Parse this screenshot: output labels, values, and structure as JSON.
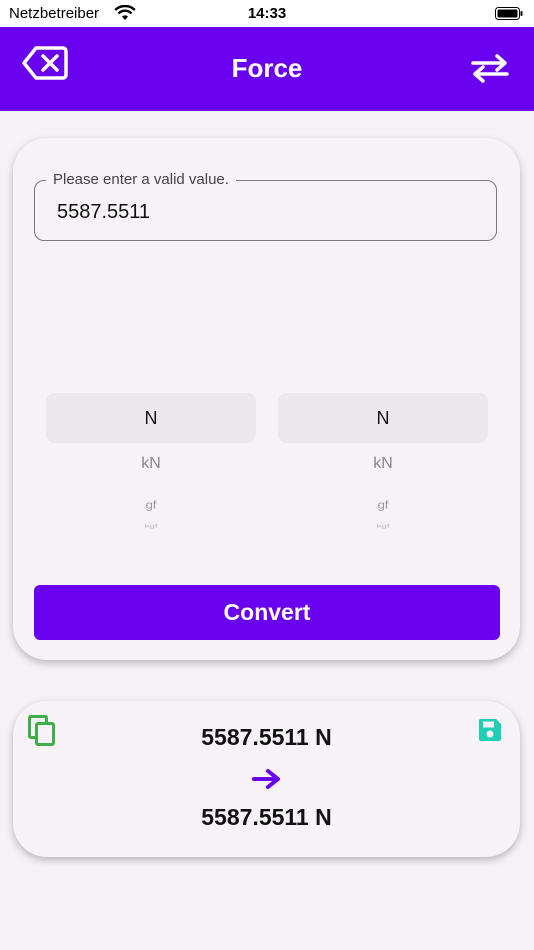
{
  "status_bar": {
    "carrier": "Netzbetreiber",
    "time": "14:33"
  },
  "app_bar": {
    "title": "Force",
    "back_icon": "backspace-x-icon",
    "swap_icon": "swap-arrows-icon"
  },
  "input": {
    "label": "Please enter a valid value.",
    "value": "5587.5511"
  },
  "from_picker": {
    "selected": "N",
    "options": [
      "kN",
      "gf",
      "kgf"
    ]
  },
  "to_picker": {
    "selected": "N",
    "options": [
      "kN",
      "gf",
      "kgf"
    ]
  },
  "convert_label": "Convert",
  "result": {
    "from": "5587.5511 N",
    "to": "5587.5511 N"
  },
  "colors": {
    "primary": "#6a00f0",
    "copy_icon": "#3fae49",
    "save_icon": "#1ecfb6",
    "background": "#f4f2f4"
  }
}
